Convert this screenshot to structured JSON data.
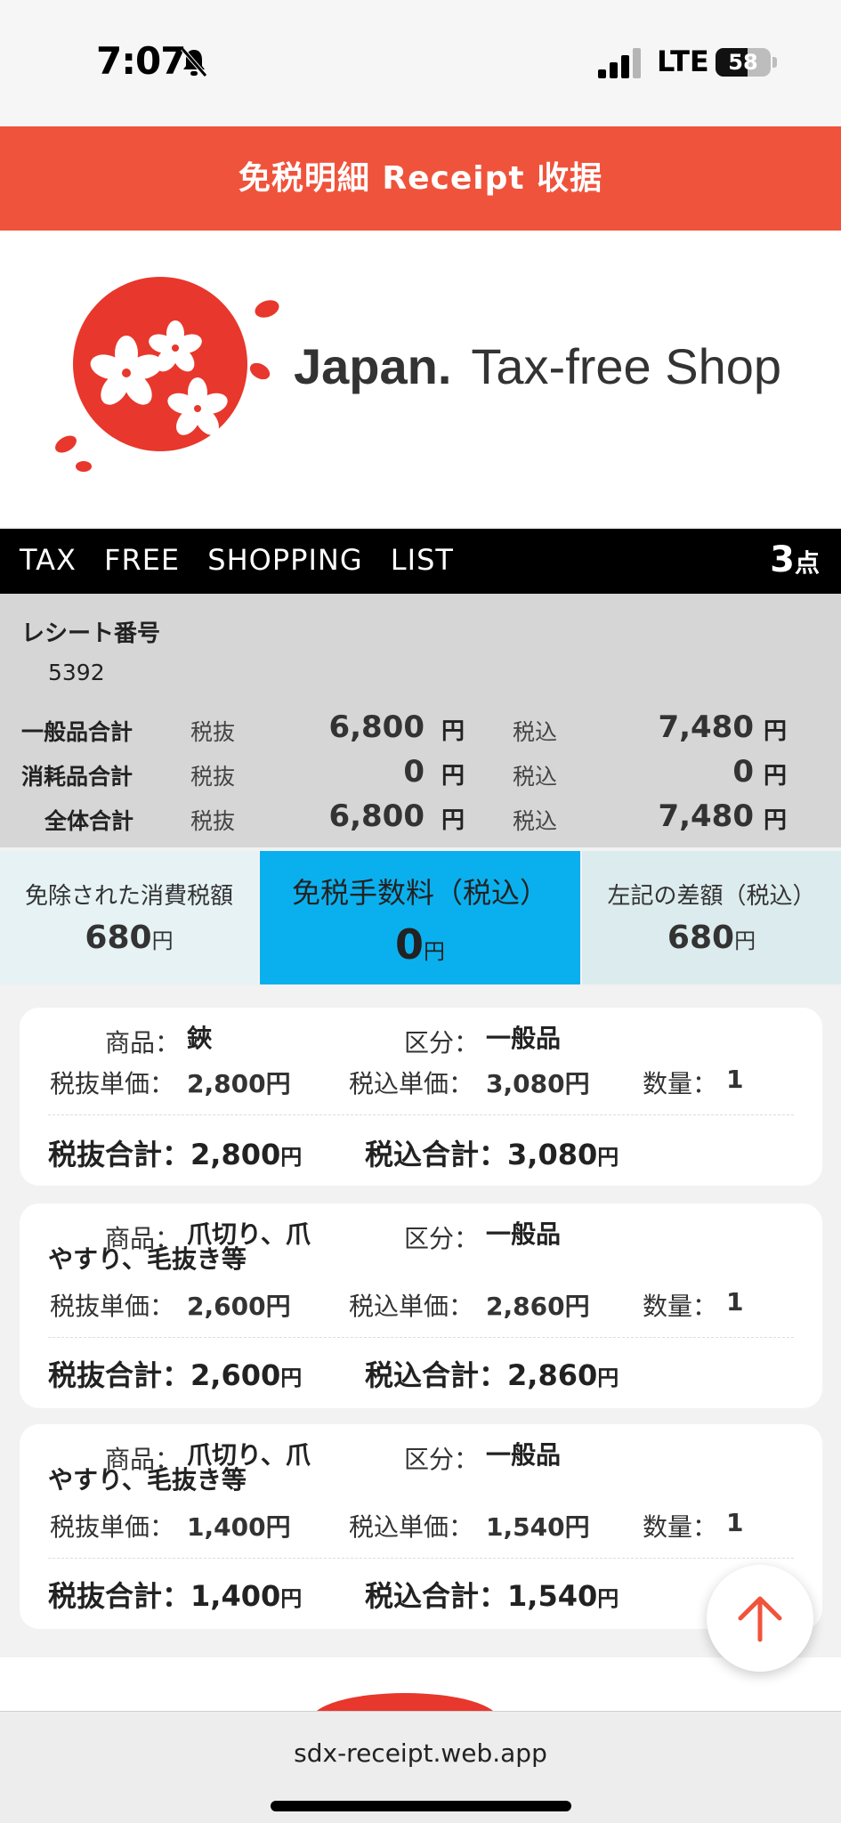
{
  "status": {
    "time": "7:07",
    "network": "LTE",
    "battery": "58",
    "battery_level": 0.58
  },
  "header": {
    "title": "免税明細 Receipt 收据"
  },
  "logo": {
    "brand_bold": "Japan.",
    "brand_rest": "Tax-free Shop"
  },
  "list_bar": {
    "title": "TAX FREE SHOPPING LIST",
    "count": "3",
    "count_unit": "点"
  },
  "receipt": {
    "label": "レシート番号",
    "number": "5392"
  },
  "summary": {
    "ex_label": "税抜",
    "in_label": "税込",
    "yen": "円",
    "rows": [
      {
        "label": "一般品合計",
        "ex": "6,800",
        "in": "7,480"
      },
      {
        "label": "消耗品合計",
        "ex": "0",
        "in": "0"
      },
      {
        "label": "全体合計",
        "ex": "6,800",
        "in": "7,480"
      }
    ]
  },
  "tax_boxes": [
    {
      "label": "免除された消費税額",
      "value": "680",
      "unit": "円"
    },
    {
      "label": "免税手数料（税込）",
      "value": "0",
      "unit": "円"
    },
    {
      "label": "左記の差額（税込）",
      "value": "680",
      "unit": "円"
    }
  ],
  "item_labels": {
    "product": "商品：",
    "category": "区分：",
    "ex_unit": "税抜単価：",
    "in_unit": "税込単価：",
    "qty": "数量：",
    "ex_total": "税抜合計：",
    "in_total": "税込合計：",
    "yen": "円"
  },
  "items": [
    {
      "name_line1": "鋏",
      "name_line2": "",
      "category": "一般品",
      "ex_unit": "2,800円",
      "in_unit": "3,080円",
      "qty": "1",
      "ex_total": "2,800",
      "in_total": "3,080"
    },
    {
      "name_line1": "爪切り、爪",
      "name_line2": "やすり、毛抜き等",
      "category": "一般品",
      "ex_unit": "2,600円",
      "in_unit": "2,860円",
      "qty": "1",
      "ex_total": "2,600",
      "in_total": "2,860"
    },
    {
      "name_line1": "爪切り、爪",
      "name_line2": "やすり、毛抜き等",
      "category": "一般品",
      "ex_unit": "1,400円",
      "in_unit": "1,540円",
      "qty": "1",
      "ex_total": "1,400",
      "in_total": "1,540"
    }
  ],
  "browser": {
    "url": "sdx-receipt.web.app"
  },
  "colors": {
    "header_red": "#f0533b",
    "fee_blue": "#0ab0ee",
    "logo_red": "#e8372c"
  }
}
